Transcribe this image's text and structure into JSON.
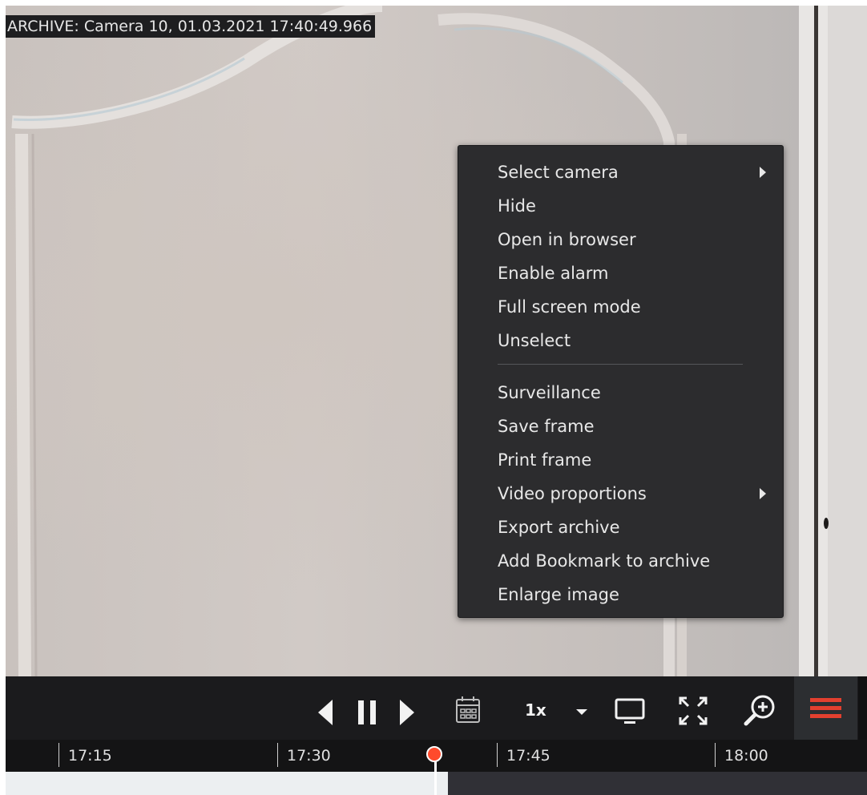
{
  "camera_overlay": {
    "title": "ARCHIVE: Camera 10, 01.03.2021 17:40:49.966"
  },
  "context_menu": {
    "items": [
      {
        "label": "Select camera",
        "submenu": true
      },
      {
        "label": "Hide",
        "submenu": false
      },
      {
        "label": "Open in browser",
        "submenu": false
      },
      {
        "label": "Enable alarm",
        "submenu": false
      },
      {
        "label": "Full screen mode",
        "submenu": false
      },
      {
        "label": "Unselect",
        "submenu": false
      },
      {
        "label": "Surveillance",
        "submenu": false
      },
      {
        "label": "Save frame",
        "submenu": false
      },
      {
        "label": "Print frame",
        "submenu": false
      },
      {
        "label": "Video proportions",
        "submenu": true
      },
      {
        "label": "Export archive",
        "submenu": false
      },
      {
        "label": "Add Bookmark to archive",
        "submenu": false
      },
      {
        "label": "Enlarge image",
        "submenu": false
      }
    ]
  },
  "toolbar": {
    "speed": "1x",
    "icons": [
      "step-back-icon",
      "pause-icon",
      "step-forward-icon",
      "calendar-icon",
      "chevron-down-icon",
      "monitor-icon",
      "fullscreen-icon",
      "zoom-in-icon",
      "hamburger-menu-icon"
    ]
  },
  "timeline": {
    "ticks": [
      "17:15",
      "17:30",
      "17:45",
      "18:00"
    ],
    "cursor_time": "17:40:49.966"
  },
  "colors": {
    "accent": "#ff4a2c",
    "menu_background": "#2c2c2e",
    "toolbar_background": "#1b1b1d"
  }
}
